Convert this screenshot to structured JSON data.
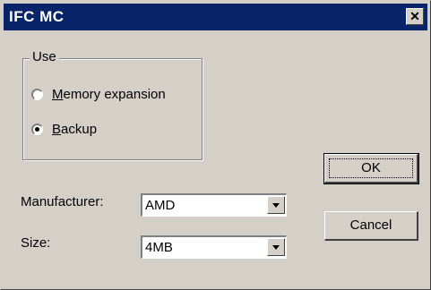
{
  "window": {
    "title": "IFC MC",
    "close_icon": "close-icon",
    "close_glyph": "✕"
  },
  "use_group": {
    "label": "Use",
    "options": [
      {
        "mnemonic": "M",
        "rest": "emory expansion",
        "checked": false
      },
      {
        "mnemonic": "B",
        "rest": "ackup",
        "checked": true
      }
    ]
  },
  "manufacturer": {
    "label": "Manufacturer:",
    "value": "AMD"
  },
  "size": {
    "label": "Size:",
    "value": "4MB"
  },
  "buttons": {
    "ok": "OK",
    "cancel": "Cancel"
  },
  "colors": {
    "title_bar": "#0a246a",
    "face": "#d4d0c8"
  }
}
